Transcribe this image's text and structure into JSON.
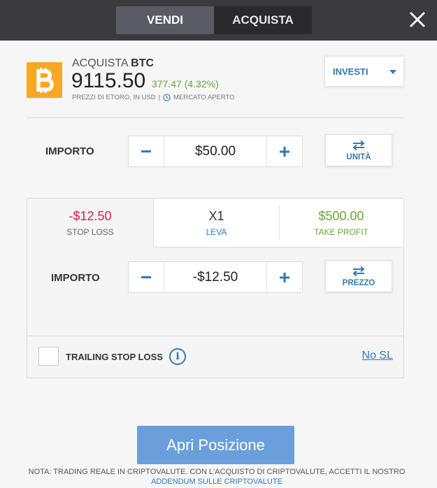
{
  "header": {
    "tabs": [
      {
        "label": "VENDI",
        "active": true
      },
      {
        "label": "ACQUISTA",
        "active": false
      }
    ],
    "close_icon": "close-icon"
  },
  "asset": {
    "action": "ACQUISTA",
    "symbol": "BTC",
    "price": "9115.50",
    "change": "377.47 (4.32%)",
    "price_source": "PREZZI DI ETORO, IN USD",
    "separator": "|",
    "market_status": "MERCATO APERTO",
    "logo_icon": "bitcoin-icon",
    "logo_color": "#f7a823"
  },
  "invest_dropdown": {
    "label": "INVESTI"
  },
  "amount": {
    "label": "IMPORTO",
    "value": "$50.00",
    "minus": "−",
    "plus": "+",
    "unit_button": "UNITÀ"
  },
  "risk_tabs": [
    {
      "value": "-$12.50",
      "caption": "STOP LOSS",
      "active": true
    },
    {
      "value": "X1",
      "caption": "LEVA",
      "active": false
    },
    {
      "value": "$500.00",
      "caption": "TAKE PROFIT",
      "active": false
    }
  ],
  "stop_loss": {
    "label": "IMPORTO",
    "value": "-$12.50",
    "minus": "−",
    "plus": "+",
    "price_button": "PREZZO"
  },
  "trailing": {
    "label": "TRAILING STOP LOSS",
    "checked": false,
    "info_icon": "i",
    "no_sl_link": "No SL"
  },
  "open_button": "Apri Posizione",
  "footer": {
    "note": "NOTA: TRADING REALE IN CRIPTOVALUTE. CON L'ACQUISTO DI CRIPTOVALUTE, ACCETTI IL NOSTRO",
    "link": "ADDENDUM SULLE CRIPTOVALUTE"
  },
  "colors": {
    "topbar": "#3a3a3f",
    "accent_blue": "#3279b8",
    "loss_red": "#d4214a",
    "gain_green": "#6aa73a",
    "primary_button": "#6a9fdc"
  }
}
